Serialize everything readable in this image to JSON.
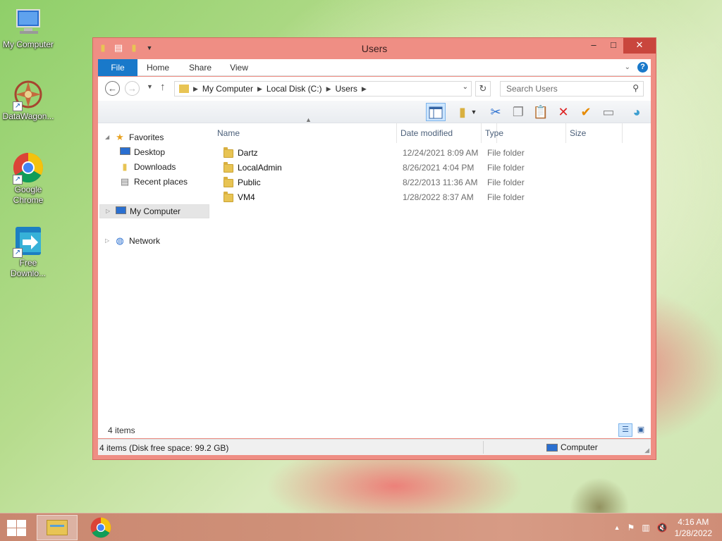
{
  "desktop": {
    "icons": [
      {
        "label": "My Computer"
      },
      {
        "label": "DataWagon..."
      },
      {
        "label": "Google Chrome"
      },
      {
        "label": "Free Downlo..."
      }
    ]
  },
  "window": {
    "title": "Users",
    "ribbon_tabs": [
      "File",
      "Home",
      "Share",
      "View"
    ],
    "address": {
      "crumbs": [
        "My Computer",
        "Local Disk (C:)",
        "Users"
      ]
    },
    "search": {
      "placeholder": "Search Users"
    },
    "nav_pane": {
      "favorites_label": "Favorites",
      "favorites": [
        "Desktop",
        "Downloads",
        "Recent places"
      ],
      "computer": "My Computer",
      "network": "Network"
    },
    "columns": [
      "Name",
      "Date modified",
      "Type",
      "Size"
    ],
    "files": [
      {
        "name": "Dartz",
        "date": "12/24/2021 8:09 AM",
        "type": "File folder"
      },
      {
        "name": "LocalAdmin",
        "date": "8/26/2021 4:04 PM",
        "type": "File folder"
      },
      {
        "name": "Public",
        "date": "8/22/2013 11:36 AM",
        "type": "File folder"
      },
      {
        "name": "VM4",
        "date": "1/28/2022 8:37 AM",
        "type": "File folder"
      }
    ],
    "item_count": "4 items",
    "status": "4 items (Disk free space: 99.2 GB)",
    "zone": "Computer"
  },
  "taskbar": {
    "time": "4:16 AM",
    "date": "1/28/2022"
  },
  "colors": {
    "accent": "#1979ca",
    "window_frame": "#ef8e84",
    "close_button": "#c9463d"
  }
}
